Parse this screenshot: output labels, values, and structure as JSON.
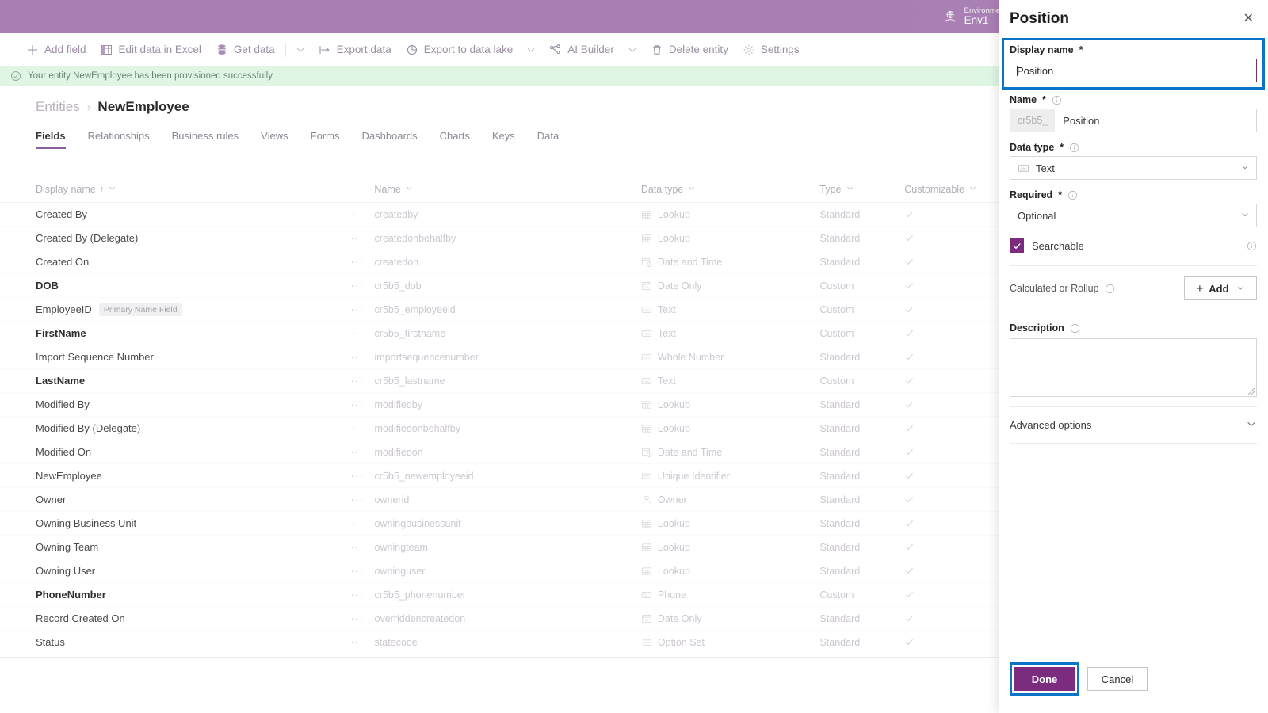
{
  "topbar": {
    "env_label": "Environment",
    "env_value": "Env1",
    "env_icon": "environment-globe-icon",
    "bg_color": "#a87fb3"
  },
  "command_bar": {
    "items": [
      {
        "label": "Add field",
        "icon": "plus-icon"
      },
      {
        "label": "Edit data in Excel",
        "icon": "excel-icon"
      },
      {
        "label": "Get data",
        "icon": "database-icon"
      },
      {
        "label": "",
        "icon": "chevron-down-icon"
      },
      {
        "label": "Export data",
        "icon": "export-arrow-icon"
      },
      {
        "label": "Export to data lake",
        "icon": "data-lake-icon"
      },
      {
        "label": "",
        "icon": "chevron-down-icon"
      },
      {
        "label": "AI Builder",
        "icon": "ai-builder-icon"
      },
      {
        "label": "",
        "icon": "chevron-down-icon"
      },
      {
        "label": "Delete entity",
        "icon": "trash-icon"
      },
      {
        "label": "Settings",
        "icon": "gear-icon"
      }
    ]
  },
  "banner": {
    "text": "Your entity NewEmployee has been provisioned successfully.",
    "icon": "check-circle-icon",
    "bg_color": "#dff6e4"
  },
  "breadcrumb": {
    "parent": "Entities",
    "separator": "›",
    "current": "NewEmployee"
  },
  "tabs": [
    {
      "label": "Fields",
      "active": true
    },
    {
      "label": "Relationships",
      "active": false
    },
    {
      "label": "Business rules",
      "active": false
    },
    {
      "label": "Views",
      "active": false
    },
    {
      "label": "Forms",
      "active": false
    },
    {
      "label": "Dashboards",
      "active": false
    },
    {
      "label": "Charts",
      "active": false
    },
    {
      "label": "Keys",
      "active": false
    },
    {
      "label": "Data",
      "active": false
    }
  ],
  "grid": {
    "columns": [
      {
        "label": "Display name",
        "sorted": "asc",
        "sort_glyph": "↑"
      },
      {
        "label": "Name",
        "sorted": "",
        "sort_glyph": ""
      },
      {
        "label": "Data type",
        "sorted": "",
        "sort_glyph": ""
      },
      {
        "label": "Type",
        "sorted": "",
        "sort_glyph": ""
      },
      {
        "label": "Customizable",
        "sorted": "",
        "sort_glyph": ""
      }
    ],
    "rows": [
      {
        "display_name": "Created By",
        "bold": false,
        "badge": "",
        "name": "createdby",
        "data_type": "Lookup",
        "dtype_icon": "lookup-icon",
        "type": "Standard",
        "customizable": true
      },
      {
        "display_name": "Created By (Delegate)",
        "bold": false,
        "badge": "",
        "name": "createdonbehalfby",
        "data_type": "Lookup",
        "dtype_icon": "lookup-icon",
        "type": "Standard",
        "customizable": true
      },
      {
        "display_name": "Created On",
        "bold": false,
        "badge": "",
        "name": "createdon",
        "data_type": "Date and Time",
        "dtype_icon": "date-time-icon",
        "type": "Standard",
        "customizable": true
      },
      {
        "display_name": "DOB",
        "bold": true,
        "badge": "",
        "name": "cr5b5_dob",
        "data_type": "Date Only",
        "dtype_icon": "date-only-icon",
        "type": "Custom",
        "customizable": true
      },
      {
        "display_name": "EmployeeID",
        "bold": false,
        "badge": "Primary Name Field",
        "name": "cr5b5_employeeid",
        "data_type": "Text",
        "dtype_icon": "text-icon",
        "type": "Custom",
        "customizable": true
      },
      {
        "display_name": "FirstName",
        "bold": true,
        "badge": "",
        "name": "cr5b5_firstname",
        "data_type": "Text",
        "dtype_icon": "text-icon",
        "type": "Custom",
        "customizable": true
      },
      {
        "display_name": "Import Sequence Number",
        "bold": false,
        "badge": "",
        "name": "importsequencenumber",
        "data_type": "Whole Number",
        "dtype_icon": "whole-number-icon",
        "type": "Standard",
        "customizable": true
      },
      {
        "display_name": "LastName",
        "bold": true,
        "badge": "",
        "name": "cr5b5_lastname",
        "data_type": "Text",
        "dtype_icon": "text-icon",
        "type": "Custom",
        "customizable": true
      },
      {
        "display_name": "Modified By",
        "bold": false,
        "badge": "",
        "name": "modifiedby",
        "data_type": "Lookup",
        "dtype_icon": "lookup-icon",
        "type": "Standard",
        "customizable": true
      },
      {
        "display_name": "Modified By (Delegate)",
        "bold": false,
        "badge": "",
        "name": "modifiedonbehalfby",
        "data_type": "Lookup",
        "dtype_icon": "lookup-icon",
        "type": "Standard",
        "customizable": true
      },
      {
        "display_name": "Modified On",
        "bold": false,
        "badge": "",
        "name": "modifiedon",
        "data_type": "Date and Time",
        "dtype_icon": "date-time-icon",
        "type": "Standard",
        "customizable": true
      },
      {
        "display_name": "NewEmployee",
        "bold": false,
        "badge": "",
        "name": "cr5b5_newemployeeid",
        "data_type": "Unique Identifier",
        "dtype_icon": "unique-identifier-icon",
        "type": "Standard",
        "customizable": true
      },
      {
        "display_name": "Owner",
        "bold": false,
        "badge": "",
        "name": "ownerid",
        "data_type": "Owner",
        "dtype_icon": "owner-person-icon",
        "type": "Standard",
        "customizable": true
      },
      {
        "display_name": "Owning Business Unit",
        "bold": false,
        "badge": "",
        "name": "owningbusinessunit",
        "data_type": "Lookup",
        "dtype_icon": "lookup-icon",
        "type": "Standard",
        "customizable": true
      },
      {
        "display_name": "Owning Team",
        "bold": false,
        "badge": "",
        "name": "owningteam",
        "data_type": "Lookup",
        "dtype_icon": "lookup-icon",
        "type": "Standard",
        "customizable": true
      },
      {
        "display_name": "Owning User",
        "bold": false,
        "badge": "",
        "name": "owninguser",
        "data_type": "Lookup",
        "dtype_icon": "lookup-icon",
        "type": "Standard",
        "customizable": true
      },
      {
        "display_name": "PhoneNumber",
        "bold": true,
        "badge": "",
        "name": "cr5b5_phonenumber",
        "data_type": "Phone",
        "dtype_icon": "phone-icon",
        "type": "Custom",
        "customizable": true
      },
      {
        "display_name": "Record Created On",
        "bold": false,
        "badge": "",
        "name": "overriddencreatedon",
        "data_type": "Date Only",
        "dtype_icon": "date-only-icon",
        "type": "Standard",
        "customizable": true
      },
      {
        "display_name": "Status",
        "bold": false,
        "badge": "",
        "name": "statecode",
        "data_type": "Option Set",
        "dtype_icon": "option-set-icon",
        "type": "Standard",
        "customizable": true
      }
    ],
    "row_menu_glyph": "···"
  },
  "panel": {
    "title": "Position",
    "close_glyph": "✕",
    "display_name": {
      "label": "Display name",
      "required_glyph": "*",
      "value": "Position",
      "highlighted": true,
      "highlight_color": "#0a74c8"
    },
    "name": {
      "label": "Name",
      "required_glyph": "*",
      "prefix": "cr5b5_",
      "value": "Position"
    },
    "data_type": {
      "label": "Data type",
      "required_glyph": "*",
      "value": "Text",
      "icon": "text-icon"
    },
    "required_field": {
      "label": "Required",
      "required_glyph": "*",
      "value": "Optional"
    },
    "searchable": {
      "label": "Searchable",
      "checked": true,
      "check_color": "#7b2c7f"
    },
    "calculated_or_rollup": {
      "label": "Calculated or Rollup",
      "add_label": "Add",
      "plus_glyph": "+"
    },
    "description": {
      "label": "Description",
      "value": ""
    },
    "advanced_options": {
      "label": "Advanced options"
    },
    "footer": {
      "done_label": "Done",
      "cancel_label": "Cancel",
      "done_highlighted": true,
      "done_color": "#7b2c7f",
      "highlight_color": "#0a74c8"
    }
  }
}
